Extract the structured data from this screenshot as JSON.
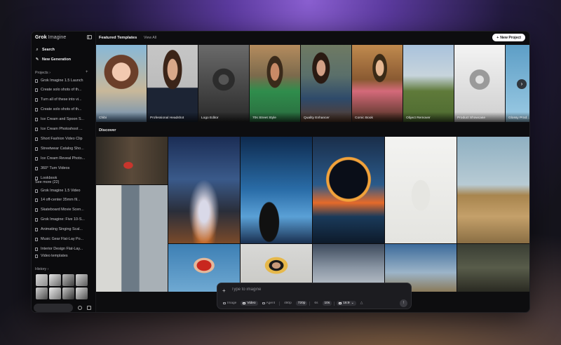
{
  "sidebar": {
    "brand_bold": "Grok",
    "brand_light": "Imagine",
    "search_label": "Search",
    "new_generation_label": "New Generation",
    "projects_label": "Projects",
    "projects_arrow": "›",
    "project_group_1": "Grok Imagine 1.5 Launch",
    "project_items_1": [
      "Create solo shots of th...",
      "Turn all of these into vi...",
      "Create solo shots of th...",
      "Ice Cream and Spoon S...",
      "Ice Cream Photoshoot ...",
      "Short Fashion Video Clip",
      "Streetwear Catalog Sho...",
      "Ice Cream Reveal Photo...",
      "360° Turn Videos",
      "Lookbook"
    ],
    "see_more": "See more (22)",
    "project_group_2": "Grok Imagine 1.5 Video",
    "project_items_2": [
      "14 off-center 35mm fil...",
      "Skateboard Movie Scen...",
      "Grok Imagine: Five 10-S...",
      "Animating Singing Scal...",
      "Music Gear Flat-Lay Po...",
      "Interior Design Flat-Lay..."
    ],
    "video_templates": "Video templates",
    "history_label": "History",
    "history_arrow": "›"
  },
  "topbar": {
    "title": "Featured Templates",
    "view_all": "View All",
    "new_project": "New Project"
  },
  "templates": [
    {
      "caption": "Chibi"
    },
    {
      "caption": "Professional Headshot"
    },
    {
      "caption": "Logo Editor"
    },
    {
      "caption": "70s Street Style"
    },
    {
      "caption": "Quality Enhancer"
    },
    {
      "caption": "Comic Book"
    },
    {
      "caption": "Object Remover"
    },
    {
      "caption": "Product Showcase"
    },
    {
      "caption": "Glossy Prod..."
    }
  ],
  "discover_label": "Discover",
  "prompt": {
    "placeholder": "Type to imagine",
    "options": [
      "Image",
      "Video",
      "Agent",
      "480p",
      "720p",
      "6s",
      "10s",
      "16:9"
    ],
    "selected_mode": "Video",
    "selected_resolution": "720p",
    "selected_duration": "10s"
  },
  "icons": {
    "search": "search-icon",
    "new_generation": "edit-icon",
    "project": "folder-icon",
    "document": "document-icon",
    "next": "chevron-right-icon",
    "send": "arrow-up-icon"
  }
}
